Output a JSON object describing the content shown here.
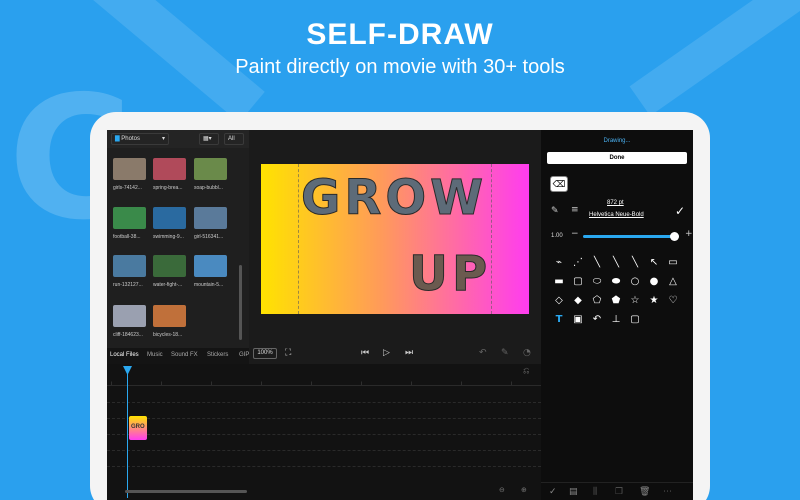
{
  "hero": {
    "title": "SELF-DRAW",
    "subtitle": "Paint directly on movie with 30+ tools"
  },
  "media": {
    "folder": "Photos",
    "all_label": "All",
    "items": [
      {
        "label": "girls-74142...",
        "color": "#8a7a6a"
      },
      {
        "label": "spring-brea...",
        "color": "#b04a5a"
      },
      {
        "label": "soap-bubbl...",
        "color": "#6a8a4a"
      },
      {
        "label": "football-38...",
        "color": "#3a8a4a"
      },
      {
        "label": "swimming-9...",
        "color": "#2a6aa0"
      },
      {
        "label": "girl-516341...",
        "color": "#5a7a9a"
      },
      {
        "label": "run-132127...",
        "color": "#4a7aa0"
      },
      {
        "label": "water-fight-...",
        "color": "#3a6a3a"
      },
      {
        "label": "mountain-5...",
        "color": "#4a8ac0"
      },
      {
        "label": "cliff-184623...",
        "color": "#9aa0b0"
      },
      {
        "label": "bicycles-18...",
        "color": "#c0703a"
      }
    ],
    "tabs": [
      "Local Files",
      "Music",
      "Sound FX",
      "Stickers",
      "GIPH"
    ]
  },
  "preview": {
    "word1": "GROW",
    "word2": "UP",
    "zoom": "100%"
  },
  "panel": {
    "status": "Drawing...",
    "done": "Done",
    "size": "872 pt",
    "font": "Helvetica Neue-Bold",
    "slider_label": "1.00",
    "slider_value": 0.95
  },
  "timeline": {
    "clip_label": "GRO"
  }
}
